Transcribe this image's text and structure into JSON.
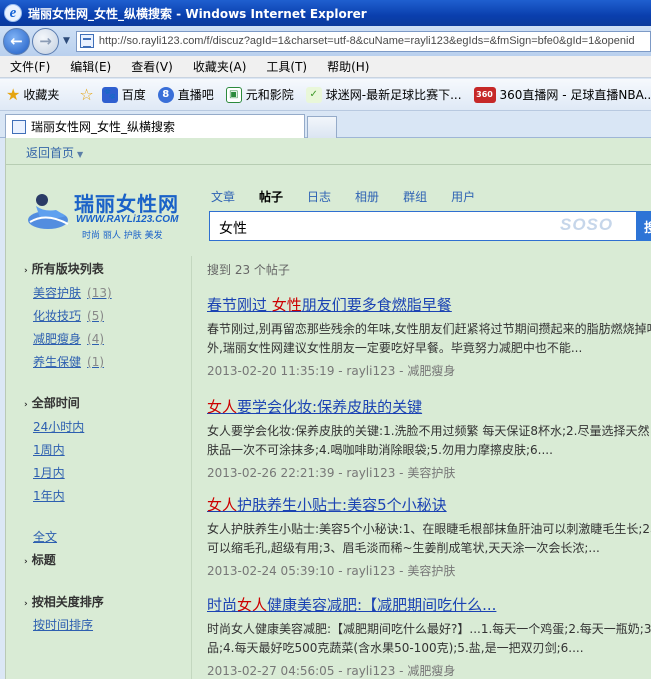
{
  "window": {
    "title": "瑞丽女性网_女性_纵横搜索 - Windows Internet Explorer"
  },
  "address": {
    "url": "http://so.rayli123.com/f/discuz?agId=1&charset=utf-8&cuName=rayli123&egIds=&fmSign=bfe0&gId=1&openid"
  },
  "menu": [
    "文件(F)",
    "编辑(E)",
    "查看(V)",
    "收藏夹(A)",
    "工具(T)",
    "帮助(H)"
  ],
  "favorites": {
    "label": "收藏夹",
    "items": [
      {
        "label": "百度",
        "icon": "baidu-icon",
        "color": "#2f5fd0"
      },
      {
        "label": "直播吧",
        "icon": "zhibo8-icon",
        "color": "#3a6fd8"
      },
      {
        "label": "元和影院",
        "icon": "yuanhe-icon",
        "color": "#2c8a3c"
      },
      {
        "label": "球迷网-最新足球比赛下...",
        "icon": "qiumi-icon",
        "color": "#3f9a2a"
      },
      {
        "label": "360直播网 - 足球直播NBA...",
        "icon": "360-icon",
        "color": "#c62828"
      }
    ]
  },
  "tab": {
    "label": "瑞丽女性网_女性_纵横搜索"
  },
  "page": {
    "back_home": "返回首页",
    "logo": {
      "brand": "瑞丽女性网",
      "site": "WWW.RAYLi123.COM",
      "slogan": "时尚 丽人 护肤 美发"
    },
    "search_tabs": [
      "文章",
      "帖子",
      "日志",
      "相册",
      "群组",
      "用户"
    ],
    "active_tab": "帖子",
    "query": "女性",
    "search_watermark": "SOSO",
    "search_button": "搜",
    "result_count": "搜到 23 个帖子",
    "sidebar": {
      "boards_title": "所有版块列表",
      "boards": [
        {
          "label": "美容护肤",
          "count": "(13)"
        },
        {
          "label": "化妆技巧",
          "count": "(5)"
        },
        {
          "label": "减肥瘦身",
          "count": "(4)"
        },
        {
          "label": "养生保健",
          "count": "(1)"
        }
      ],
      "time_title": "全部时间",
      "times": [
        "24小时内",
        "1周内",
        "1月内",
        "1年内"
      ],
      "scope_link": "全文",
      "scope_selected": "标题",
      "sort_title": "按相关度排序",
      "sort_link": "按时间排序"
    },
    "results": [
      {
        "title_pre": "春节刚过 ",
        "title_hl": "女性",
        "title_post": "朋友们要多食燃脂早餐",
        "line1": "春节刚过,别再留恋那些残余的年味,女性朋友们赶紧将过节期间攒起来的脂肪燃烧掉吧。",
        "line2": "外,瑞丽女性网建议女性朋友一定要吃好早餐。毕竟努力减肥中也不能...",
        "meta": "2013-02-20 11:35:19 - rayli123 - 减肥瘦身"
      },
      {
        "title_pre": "",
        "title_hl": "女人",
        "title_post": "要学会化妆:保养皮肤的关键",
        "line1": "女人要学会化妆:保养皮肤的关键:1.洗脸不用过频繁 每天保证8杯水;2.尽量选择天然",
        "line2": "肤品一次不可涂抹多;4.喝咖啡助消除眼袋;5.勿用力摩擦皮肤;6....",
        "meta": "2013-02-26 22:21:39 - rayli123 - 美容护肤"
      },
      {
        "title_pre": "",
        "title_hl": "女人",
        "title_post": "护肤养生小贴士:美容5个小秘诀",
        "line1": "女人护肤养生小贴士:美容5个小秘诀:1、在眼睫毛根部抹鱼肝油可以刺激睫毛生长;2、",
        "line2": "可以缩毛孔,超级有用;3、眉毛淡而稀~生姜削成笔状,天天涂一次会长浓;...",
        "meta": "2013-02-24 05:39:10 - rayli123 - 美容护肤"
      },
      {
        "title_pre": "时尚",
        "title_hl": "女人",
        "title_post": "健康美容减肥:【减肥期间吃什么...",
        "line1": "时尚女人健康美容减肥:【减肥期间吃什么最好?】...1.每天一个鸡蛋;2.每天一瓶奶;3",
        "line2": "品;4.每天最好吃500克蔬菜(含水果50-100克);5.盐,是一把双刃剑;6....",
        "meta": "2013-02-27 04:56:05 - rayli123 - 减肥瘦身"
      }
    ]
  }
}
